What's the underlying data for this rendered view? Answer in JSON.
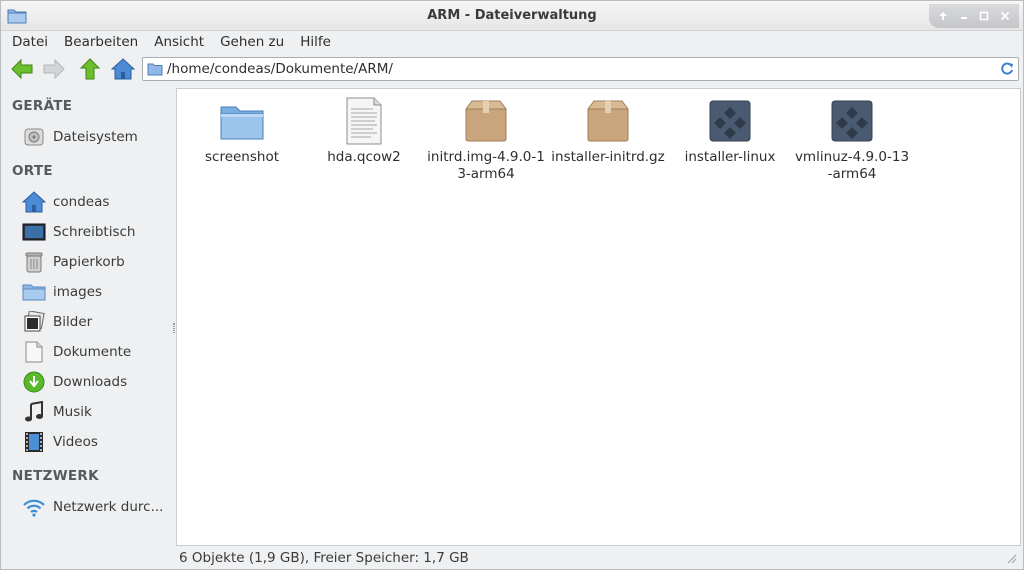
{
  "window": {
    "title": "ARM - Dateiverwaltung"
  },
  "menu": [
    "Datei",
    "Bearbeiten",
    "Ansicht",
    "Gehen zu",
    "Hilfe"
  ],
  "location": {
    "path": "/home/condeas/Dokumente/ARM/"
  },
  "sidebar": {
    "sections": [
      {
        "header": "GERÄTE",
        "items": [
          {
            "label": "Dateisystem",
            "icon": "drive-icon"
          }
        ]
      },
      {
        "header": "ORTE",
        "items": [
          {
            "label": "condeas",
            "icon": "home-icon"
          },
          {
            "label": "Schreibtisch",
            "icon": "desktop-icon"
          },
          {
            "label": "Papierkorb",
            "icon": "trash-icon"
          },
          {
            "label": "images",
            "icon": "folder-icon"
          },
          {
            "label": "Bilder",
            "icon": "pictures-icon"
          },
          {
            "label": "Dokumente",
            "icon": "document-icon"
          },
          {
            "label": "Downloads",
            "icon": "download-icon"
          },
          {
            "label": "Musik",
            "icon": "music-icon"
          },
          {
            "label": "Videos",
            "icon": "video-icon"
          }
        ]
      },
      {
        "header": "NETZWERK",
        "items": [
          {
            "label": "Netzwerk durc...",
            "icon": "wifi-icon"
          }
        ]
      }
    ]
  },
  "files": [
    {
      "name": "screenshot",
      "icon": "folder-icon"
    },
    {
      "name": "hda.qcow2",
      "icon": "text-file-icon"
    },
    {
      "name": "initrd.img-4.9.0-13-arm64",
      "icon": "package-icon"
    },
    {
      "name": "installer-initrd.gz",
      "icon": "package-icon"
    },
    {
      "name": "installer-linux",
      "icon": "executable-icon"
    },
    {
      "name": "vmlinuz-4.9.0-13-arm64",
      "icon": "executable-icon"
    }
  ],
  "status": {
    "text": "6 Objekte (1,9 GB), Freier Speicher: 1,7 GB"
  },
  "colors": {
    "accent_blue": "#3d7fcf",
    "back_green": "#5aa827",
    "folder_blue": "#7aaee0",
    "package_tan": "#c8a57c",
    "exec_slate": "#4a5a70"
  }
}
